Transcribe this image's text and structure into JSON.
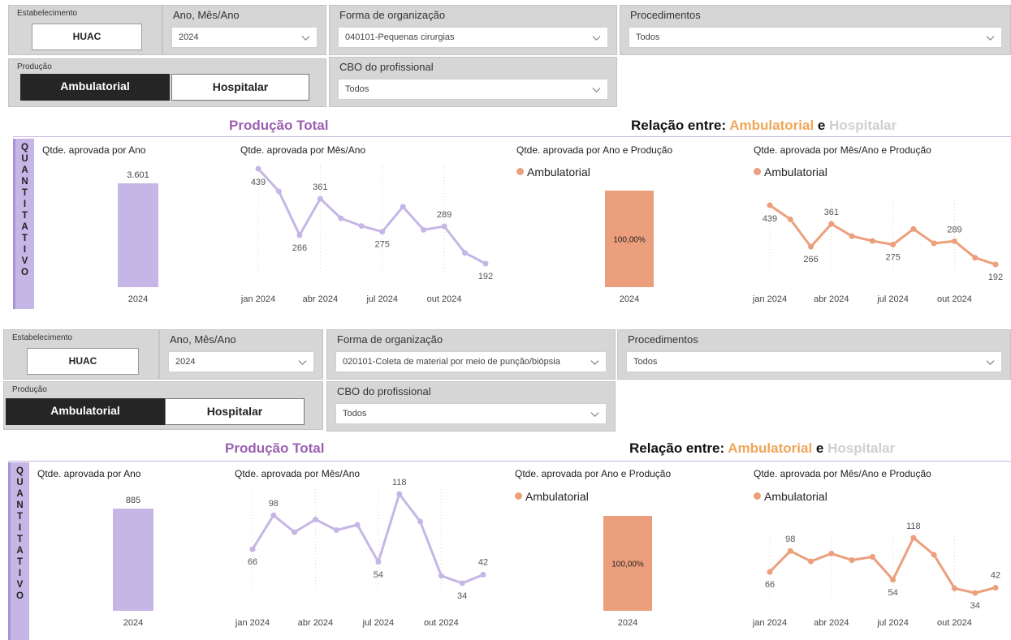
{
  "sections": [
    {
      "filters": {
        "estabelecimento": {
          "title": "Estabelecimento",
          "value": "HUAC"
        },
        "ano": {
          "title": "Ano, Mês/Ano",
          "value": "2024"
        },
        "forma": {
          "title": "Forma de organização",
          "value": "040101-Pequenas cirurgias"
        },
        "procedimentos": {
          "title": "Procedimentos",
          "value": "Todos"
        },
        "producao": {
          "title": "Produção",
          "options": [
            "Ambulatorial",
            "Hospitalar"
          ],
          "selected": "Ambulatorial"
        },
        "cbo": {
          "title": "CBO do profissional",
          "value": "Todos"
        }
      },
      "headers": {
        "producao_total": "Produção Total",
        "relacao_prefix": "Relação entre:",
        "relacao_a": "Ambulatorial",
        "relacao_e": "e",
        "relacao_b": "Hospitalar"
      },
      "sidebar_letters": [
        "Q",
        "U",
        "A",
        "N",
        "T",
        "I",
        "T",
        "A",
        "T",
        "I",
        "V",
        "O"
      ],
      "visuals": {
        "por_ano": {
          "title": "Qtde. aprovada por Ano"
        },
        "por_mes": {
          "title": "Qtde. aprovada por Mês/Ano"
        },
        "por_ano_prod": {
          "title": "Qtde. aprovada por Ano e Produção",
          "legend": "Ambulatorial"
        },
        "por_mes_prod": {
          "title": "Qtde. aprovada por Mês/Ano e Produção",
          "legend": "Ambulatorial"
        }
      }
    },
    {
      "filters": {
        "estabelecimento": {
          "title": "Estabelecimento",
          "value": "HUAC"
        },
        "ano": {
          "title": "Ano, Mês/Ano",
          "value": "2024"
        },
        "forma": {
          "title": "Forma de organização",
          "value": "020101-Coleta de material por meio de punção/biópsia"
        },
        "procedimentos": {
          "title": "Procedimentos",
          "value": "Todos"
        },
        "producao": {
          "title": "Produção",
          "options": [
            "Ambulatorial",
            "Hospitalar"
          ],
          "selected": "Ambulatorial"
        },
        "cbo": {
          "title": "CBO do profissional",
          "value": "Todos"
        }
      },
      "headers": {
        "producao_total": "Produção Total",
        "relacao_prefix": "Relação entre:",
        "relacao_a": "Ambulatorial",
        "relacao_e": "e",
        "relacao_b": "Hospitalar"
      },
      "sidebar_letters": [
        "Q",
        "U",
        "A",
        "N",
        "T",
        "I",
        "T",
        "A",
        "T",
        "I",
        "V",
        "O"
      ],
      "visuals": {
        "por_ano": {
          "title": "Qtde. aprovada por Ano"
        },
        "por_mes": {
          "title": "Qtde. aprovada por Mês/Ano"
        },
        "por_ano_prod": {
          "title": "Qtde. aprovada por Ano e Produção",
          "legend": "Ambulatorial"
        },
        "por_mes_prod": {
          "title": "Qtde. aprovada por Mês/Ano e Produção",
          "legend": "Ambulatorial"
        }
      }
    }
  ],
  "colors": {
    "purple_series": "#c6b6e6",
    "orange_series": "#ec9f7c",
    "sidebar": "#c6b6e6"
  },
  "chart_data": [
    {
      "type": "bar",
      "title": "Qtde. aprovada por Ano",
      "categories": [
        "2024"
      ],
      "values": [
        3601
      ],
      "data_labels": [
        "3.601"
      ],
      "color": "#c6b6e6"
    },
    {
      "type": "line",
      "title": "Qtde. aprovada por Mês/Ano",
      "x": [
        "jan 2024",
        "fev 2024",
        "mar 2024",
        "abr 2024",
        "mai 2024",
        "jun 2024",
        "jul 2024",
        "ago 2024",
        "set 2024",
        "out 2024",
        "nov 2024",
        "dez 2024"
      ],
      "values": [
        439,
        380,
        266,
        361,
        310,
        290,
        275,
        340,
        280,
        289,
        220,
        192
      ],
      "x_tick_labels": [
        "jan 2024",
        "abr 2024",
        "jul 2024",
        "out 2024"
      ],
      "point_labels": {
        "0": "439",
        "2": "266",
        "3": "361",
        "6": "275",
        "9": "289",
        "11": "192"
      },
      "color": "#c6b6e6"
    },
    {
      "type": "bar",
      "title": "Qtde. aprovada por Ano e Produção",
      "categories": [
        "2024"
      ],
      "series": [
        {
          "name": "Ambulatorial",
          "values": [
            100
          ]
        }
      ],
      "data_labels": [
        "100,00%"
      ],
      "color": "#ec9f7c"
    },
    {
      "type": "line",
      "title": "Qtde. aprovada por Mês/Ano e Produção",
      "x": [
        "jan 2024",
        "fev 2024",
        "mar 2024",
        "abr 2024",
        "mai 2024",
        "jun 2024",
        "jul 2024",
        "ago 2024",
        "set 2024",
        "out 2024",
        "nov 2024",
        "dez 2024"
      ],
      "series": [
        {
          "name": "Ambulatorial",
          "values": [
            439,
            380,
            266,
            361,
            310,
            290,
            275,
            340,
            280,
            289,
            220,
            192
          ]
        }
      ],
      "x_tick_labels": [
        "jan 2024",
        "abr 2024",
        "jul 2024",
        "out 2024"
      ],
      "point_labels": {
        "0": "439",
        "2": "266",
        "3": "361",
        "6": "275",
        "9": "289",
        "11": "192"
      },
      "color": "#ec9f7c"
    },
    {
      "type": "bar",
      "title": "Qtde. aprovada por Ano",
      "categories": [
        "2024"
      ],
      "values": [
        885
      ],
      "data_labels": [
        "885"
      ],
      "color": "#c6b6e6"
    },
    {
      "type": "line",
      "title": "Qtde. aprovada por Mês/Ano",
      "x": [
        "jan 2024",
        "fev 2024",
        "mar 2024",
        "abr 2024",
        "mai 2024",
        "jun 2024",
        "jul 2024",
        "ago 2024",
        "set 2024",
        "out 2024",
        "nov 2024",
        "dez 2024"
      ],
      "values": [
        66,
        98,
        82,
        94,
        84,
        89,
        54,
        118,
        92,
        41,
        34,
        42
      ],
      "x_tick_labels": [
        "jan 2024",
        "abr 2024",
        "jul 2024",
        "out 2024"
      ],
      "point_labels": {
        "0": "66",
        "1": "98",
        "6": "54",
        "7": "118",
        "10": "34",
        "11": "42"
      },
      "color": "#c6b6e6"
    },
    {
      "type": "bar",
      "title": "Qtde. aprovada por Ano e Produção",
      "categories": [
        "2024"
      ],
      "series": [
        {
          "name": "Ambulatorial",
          "values": [
            100
          ]
        }
      ],
      "data_labels": [
        "100,00%"
      ],
      "color": "#ec9f7c"
    },
    {
      "type": "line",
      "title": "Qtde. aprovada por Mês/Ano e Produção",
      "x": [
        "jan 2024",
        "fev 2024",
        "mar 2024",
        "abr 2024",
        "mai 2024",
        "jun 2024",
        "jul 2024",
        "ago 2024",
        "set 2024",
        "out 2024",
        "nov 2024",
        "dez 2024"
      ],
      "series": [
        {
          "name": "Ambulatorial",
          "values": [
            66,
            98,
            82,
            94,
            84,
            89,
            54,
            118,
            92,
            41,
            34,
            42
          ]
        }
      ],
      "x_tick_labels": [
        "jan 2024",
        "abr 2024",
        "jul 2024",
        "out 2024"
      ],
      "point_labels": {
        "0": "66",
        "1": "98",
        "6": "54",
        "7": "118",
        "10": "34",
        "11": "42"
      },
      "color": "#ec9f7c"
    }
  ]
}
